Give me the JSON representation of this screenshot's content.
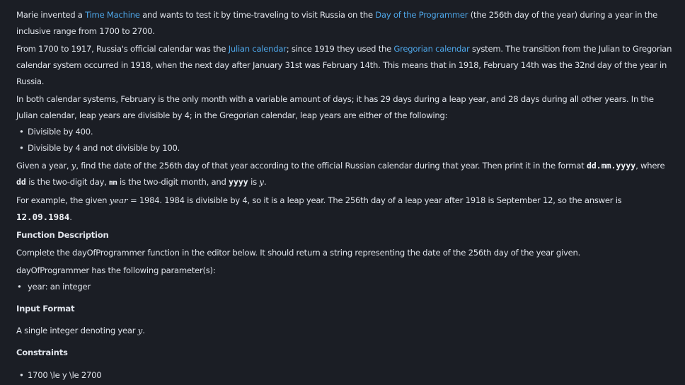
{
  "intro": {
    "t1": "Marie invented a ",
    "link1": "Time Machine",
    "t2": " and wants to test it by time-traveling to visit Russia on the ",
    "link2": "Day of the Programmer",
    "t3": " (the 256th day of the year) during a year in the inclusive range from 1700 to 2700."
  },
  "history": {
    "t1": "From 1700 to 1917, Russia's official calendar was the ",
    "link1": "Julian calendar",
    "t2": "; since 1919 they used the ",
    "link2": "Gregorian calendar",
    "t3": " system. The transition from the Julian to Gregorian calendar system occurred in 1918, when the next day after January 31st was February 14th. This means that in 1918, February 14th was the 32nd day of the year in Russia."
  },
  "leap_rules": {
    "text": "In both calendar systems, February is the only month with a variable amount of days; it has 29 days during a leap year, and 28 days during all other years. In the Julian calendar, leap years are divisible by 4; in the Gregorian calendar, leap years are either of the following:",
    "bullets": [
      "Divisible by 400.",
      "Divisible by 4 and not divisible by 100."
    ]
  },
  "task": {
    "t1": "Given a year, ",
    "var_y": "y",
    "t2": ", find the date of the 256th day of that year according to the official Russian calendar during that year. Then print it in the format ",
    "format": "dd.mm.yyyy",
    "t3": ", where ",
    "dd": "dd",
    "t4": " is the two-digit day, ",
    "mm": "mm",
    "t5": " is the two-digit month, and ",
    "yyyy": "yyyy",
    "t6": " is ",
    "var_y2": "y",
    "t7": "."
  },
  "example": {
    "t1": "For example, the given ",
    "var_year": "year",
    "t2": " = 1984. 1984 is divisible by 4, so it is a leap year. The 256th day of a leap year after 1918 is September 12, so the answer is ",
    "answer": "12.09.1984",
    "t3": "."
  },
  "function_description": {
    "heading": "Function Description",
    "text": "Complete the dayOfProgrammer function in the editor below. It should return a string representing the date of the 256th day of the year given.",
    "params_intro": "dayOfProgrammer has the following parameter(s):",
    "params": [
      "year: an integer"
    ]
  },
  "input_format": {
    "heading": "Input Format",
    "t1": "A single integer denoting year ",
    "var_y": "y",
    "t2": "."
  },
  "constraints": {
    "heading": "Constraints",
    "items": [
      "1700 \\le y \\le 2700"
    ]
  },
  "bullet_char": "•",
  "colors": {
    "background": "#1b1e25",
    "text": "#dfe3ea",
    "link": "#4ea6e8"
  }
}
